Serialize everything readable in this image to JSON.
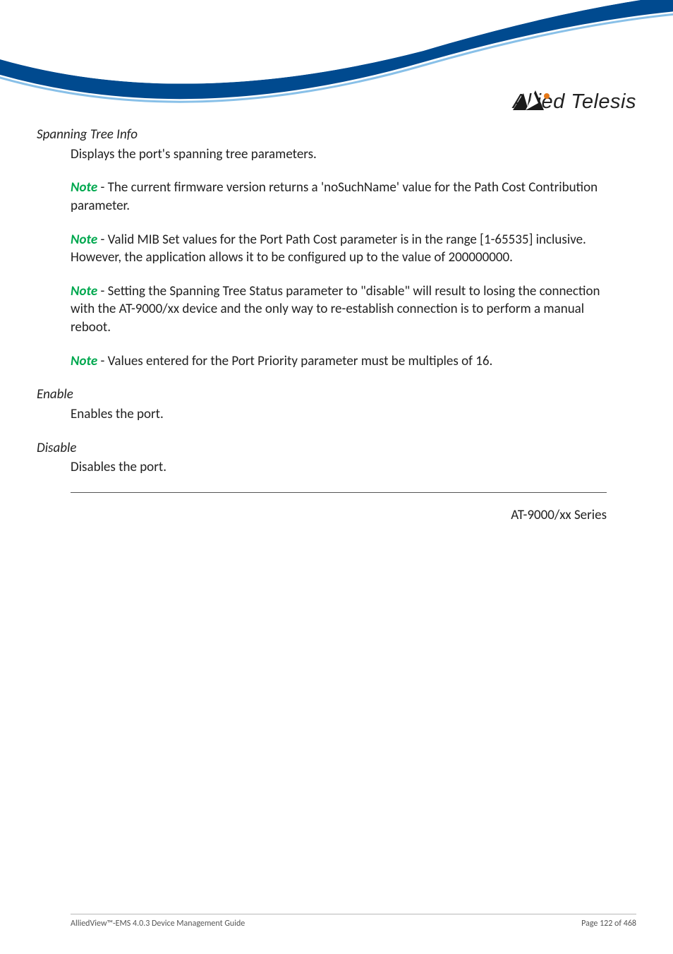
{
  "logo_text": "Allied Telesis",
  "sections": {
    "spanning_tree": {
      "title": "Spanning Tree Info",
      "body": "Displays the port's spanning tree parameters.",
      "notes": [
        "- The current firmware version returns a 'noSuchName' value for the Path Cost Contribution parameter.",
        "- Valid MIB Set values for the Port Path Cost parameter is in the range [1-65535] inclusive. However, the application allows it to be configured up to the value of 200000000.",
        "- Setting the Spanning Tree Status parameter to \"disable\" will result to losing the connection with the AT-9000/xx device and the only way to re-establish connection is to perform a manual reboot.",
        "- Values entered for the Port Priority parameter must be multiples of 16."
      ]
    },
    "enable": {
      "title": "Enable",
      "body": "Enables the port."
    },
    "disable": {
      "title": "Disable",
      "body": "Disables the port."
    }
  },
  "note_label": "Note",
  "series_label": "AT-9000/xx Series",
  "footer": {
    "left": "AlliedView™-EMS 4.0.3 Device Management Guide",
    "right": "Page 122 of 468"
  }
}
